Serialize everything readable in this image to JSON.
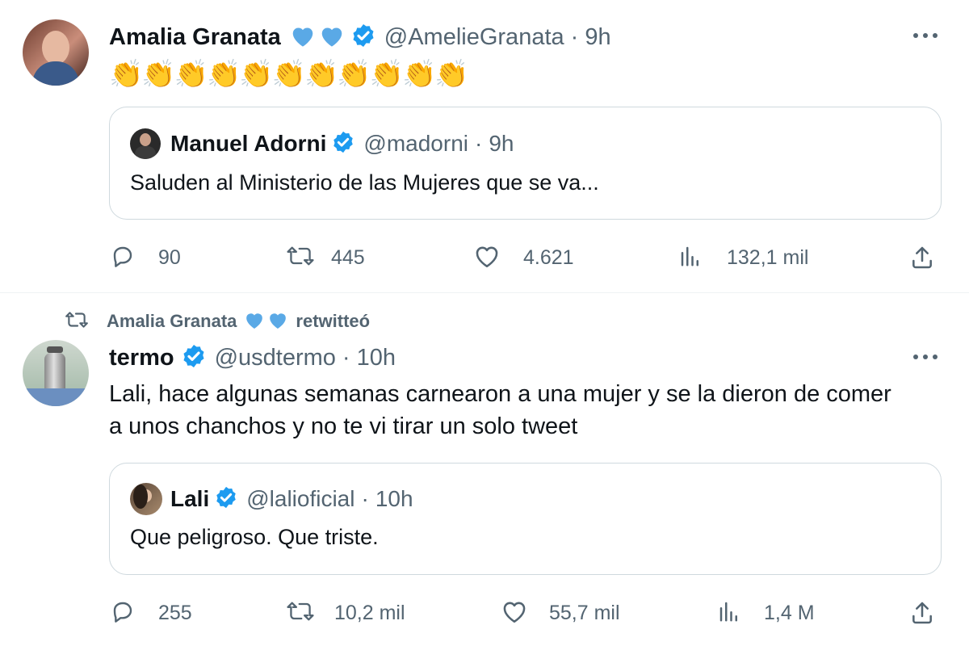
{
  "tweet1": {
    "author_name": "Amalia Granata",
    "author_handle": "@AmelieGranata",
    "time": "9h",
    "text_emoji": "👏👏👏👏👏👏👏👏👏👏👏",
    "quote": {
      "author_name": "Manuel Adorni",
      "author_handle": "@madorni",
      "time": "9h",
      "text": "Saluden al Ministerio de las Mujeres que se va..."
    },
    "actions": {
      "replies": "90",
      "retweets": "445",
      "likes": "4.621",
      "views": "132,1 mil"
    }
  },
  "tweet2": {
    "retweeted_by": "Amalia Granata",
    "retweet_label": "retwitteó",
    "author_name": "termo",
    "author_handle": "@usdtermo",
    "time": "10h",
    "text_line1": "Lali, hace algunas semanas carnearon a una mujer y se la dieron de comer",
    "text_line2": "a unos chanchos y no te vi tirar un solo tweet",
    "quote": {
      "author_name": "Lali",
      "author_handle": "@lalioficial",
      "time": "10h",
      "text": "Que peligroso. Que triste."
    },
    "actions": {
      "replies": "255",
      "retweets": "10,2 mil",
      "likes": "55,7 mil",
      "views": "1,4 M"
    }
  },
  "separator": "·",
  "colors": {
    "verified": "#1d9bf0",
    "heart_blue": "#5aa9e6",
    "muted": "#536471",
    "border": "#cfd9de"
  },
  "icons": [
    "more-icon",
    "reply-icon",
    "retweet-icon",
    "like-icon",
    "views-icon",
    "share-icon",
    "verified-icon",
    "blue-heart-icon"
  ]
}
